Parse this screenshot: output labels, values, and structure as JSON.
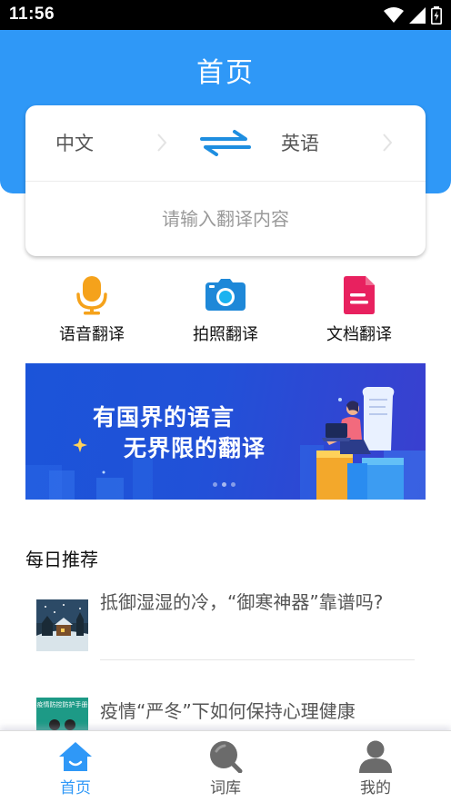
{
  "status_bar": {
    "time": "11:56",
    "icons": [
      "wifi-icon",
      "signal-icon",
      "battery-icon"
    ]
  },
  "header": {
    "title": "首页",
    "color": "#2f98f7"
  },
  "translator": {
    "source_lang": "中文",
    "target_lang": "英语",
    "input_placeholder": "请输入翻译内容",
    "swap_icon": "swap-arrows-icon"
  },
  "actions": [
    {
      "label": "语音翻译",
      "icon": "microphone-icon",
      "color": "#f5a21b"
    },
    {
      "label": "拍照翻译",
      "icon": "camera-icon",
      "color": "#1e88d8"
    },
    {
      "label": "文档翻译",
      "icon": "document-icon",
      "color": "#e8215f"
    }
  ],
  "banner": {
    "line1": "有国界的语言",
    "line2": "无界限的翻译",
    "slides": 3,
    "active_slide": 2
  },
  "daily": {
    "title": "每日推荐",
    "articles": [
      {
        "title": "抵御湿湿的冷，“御寒神器”靠谱吗?"
      },
      {
        "title": "疫情“严冬”下如何保持心理健康",
        "thumb_text": "疫情防控防护手册"
      }
    ]
  },
  "bottom_nav": {
    "items": [
      {
        "label": "首页",
        "icon": "home-icon",
        "active": true
      },
      {
        "label": "词库",
        "icon": "search-icon",
        "active": false
      },
      {
        "label": "我的",
        "icon": "user-icon",
        "active": false
      }
    ],
    "active_color": "#2f98f7",
    "inactive_color": "#555555"
  }
}
